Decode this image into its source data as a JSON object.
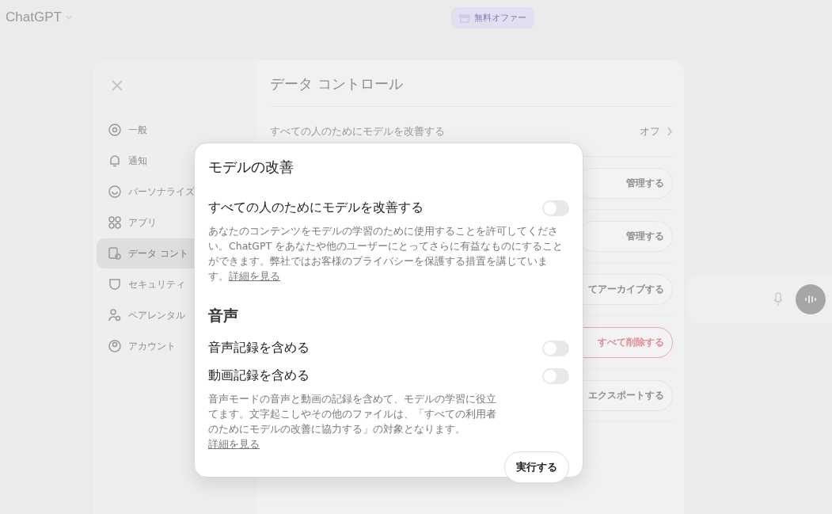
{
  "top_bar": {
    "model": "ChatGPT",
    "offer": "無料オファー"
  },
  "settings": {
    "sidebar": [
      {
        "label": "一般",
        "selected": false
      },
      {
        "label": "通知",
        "selected": false
      },
      {
        "label": "パーソナライズ",
        "selected": false
      },
      {
        "label": "アプリ",
        "selected": false
      },
      {
        "label": "データ コント",
        "selected": true
      },
      {
        "label": "セキュリティ",
        "selected": false
      },
      {
        "label": "ペアレンタル",
        "selected": false
      },
      {
        "label": "アカウント",
        "selected": false
      }
    ],
    "title": "データ コントロール",
    "first_row": {
      "label": "すべての人のためにモデルを改善する",
      "value": "オフ"
    },
    "buttons": [
      {
        "label": "管理する",
        "kind": "normal"
      },
      {
        "label": "管理する",
        "kind": "normal"
      },
      {
        "label": "てアーカイブする",
        "kind": "normal"
      },
      {
        "label": "すべて削除する",
        "kind": "danger"
      },
      {
        "label": "エクスポートする",
        "kind": "normal"
      }
    ]
  },
  "modal": {
    "title": "モデルの改善",
    "sections": [
      {
        "toggles": [
          {
            "label": "すべての人のためにモデルを改善する",
            "on": false
          }
        ],
        "description": "あなたのコンテンツをモデルの学習のために使用することを許可してください。ChatGPT をあなたや他のユーザーにとってさらに有益なものにすることができます。弊社ではお客様のプライバシーを保護する措置を講じています。",
        "link": "詳細を見る"
      },
      {
        "heading": "音声",
        "toggles": [
          {
            "label": "音声記録を含める",
            "on": false
          },
          {
            "label": "動画記録を含める",
            "on": false
          }
        ],
        "description": "音声モードの音声と動画の記録を含めて、モデルの学習に役立てます。文字起こしやその他のファイルは、「すべての利用者のためにモデルの改善に協力する」の対象となります。",
        "link": "詳細を見る"
      }
    ],
    "action": "実行する"
  }
}
